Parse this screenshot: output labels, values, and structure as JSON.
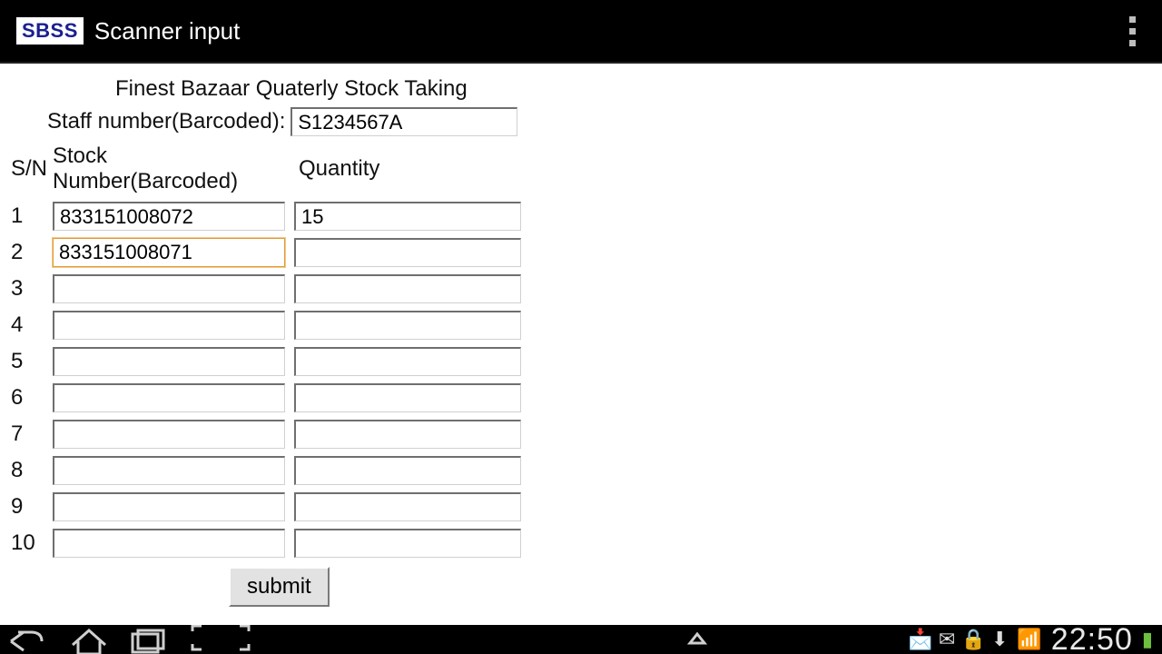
{
  "app": {
    "logo": "SBSS",
    "title": "Scanner input"
  },
  "form": {
    "heading": "Finest Bazaar Quaterly Stock Taking",
    "staff_label": "Staff number(Barcoded):",
    "staff_value": "S1234567A",
    "col_sn": "S/N",
    "col_stock": "Stock Number(Barcoded)",
    "col_qty": "Quantity",
    "rows": [
      {
        "sn": "1",
        "stock": "833151008072",
        "qty": "15",
        "focused": false
      },
      {
        "sn": "2",
        "stock": "833151008071",
        "qty": "",
        "focused": true
      },
      {
        "sn": "3",
        "stock": "",
        "qty": "",
        "focused": false
      },
      {
        "sn": "4",
        "stock": "",
        "qty": "",
        "focused": false
      },
      {
        "sn": "5",
        "stock": "",
        "qty": "",
        "focused": false
      },
      {
        "sn": "6",
        "stock": "",
        "qty": "",
        "focused": false
      },
      {
        "sn": "7",
        "stock": "",
        "qty": "",
        "focused": false
      },
      {
        "sn": "8",
        "stock": "",
        "qty": "",
        "focused": false
      },
      {
        "sn": "9",
        "stock": "",
        "qty": "",
        "focused": false
      },
      {
        "sn": "10",
        "stock": "",
        "qty": "",
        "focused": false
      }
    ],
    "submit": "submit"
  },
  "status": {
    "time": "22:50"
  }
}
